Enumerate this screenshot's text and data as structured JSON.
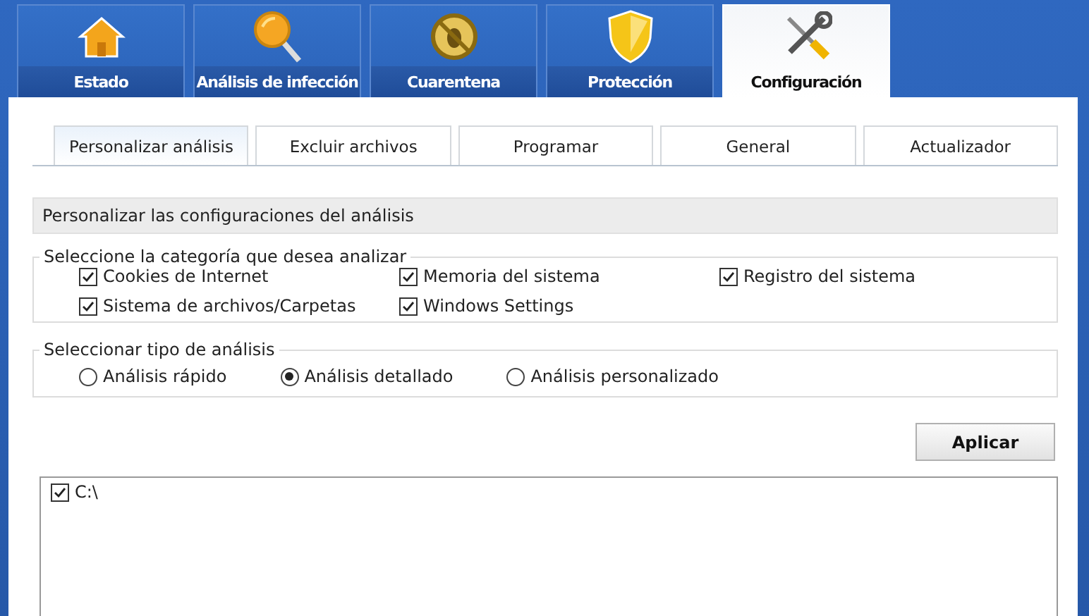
{
  "main_tabs": [
    {
      "label": "Estado",
      "selected": false
    },
    {
      "label": "Análisis de infección",
      "selected": false
    },
    {
      "label": "Cuarentena",
      "selected": false
    },
    {
      "label": "Protección",
      "selected": false
    },
    {
      "label": "Configuración",
      "selected": true
    }
  ],
  "sub_tabs": [
    {
      "label": "Personalizar análisis",
      "selected": true
    },
    {
      "label": "Excluir archivos",
      "selected": false
    },
    {
      "label": "Programar",
      "selected": false
    },
    {
      "label": "General",
      "selected": false
    },
    {
      "label": "Actualizador",
      "selected": false
    }
  ],
  "section_title": "Personalizar las configuraciones del análisis",
  "categories": {
    "legend": "Seleccione la categoría que desea analizar",
    "items": [
      {
        "label": "Cookies de Internet",
        "checked": true
      },
      {
        "label": "Memoria del sistema",
        "checked": true
      },
      {
        "label": "Registro del sistema",
        "checked": true
      },
      {
        "label": "Sistema de archivos/Carpetas",
        "checked": true
      },
      {
        "label": "Windows Settings",
        "checked": true
      }
    ]
  },
  "scan_type": {
    "legend": "Seleccionar tipo de análisis",
    "options": [
      {
        "label": "Análisis rápido",
        "selected": false
      },
      {
        "label": "Análisis detallado",
        "selected": true
      },
      {
        "label": "Análisis personalizado",
        "selected": false
      }
    ]
  },
  "apply_button": "Aplicar",
  "drives": [
    {
      "label": "C:\\",
      "checked": true
    }
  ]
}
